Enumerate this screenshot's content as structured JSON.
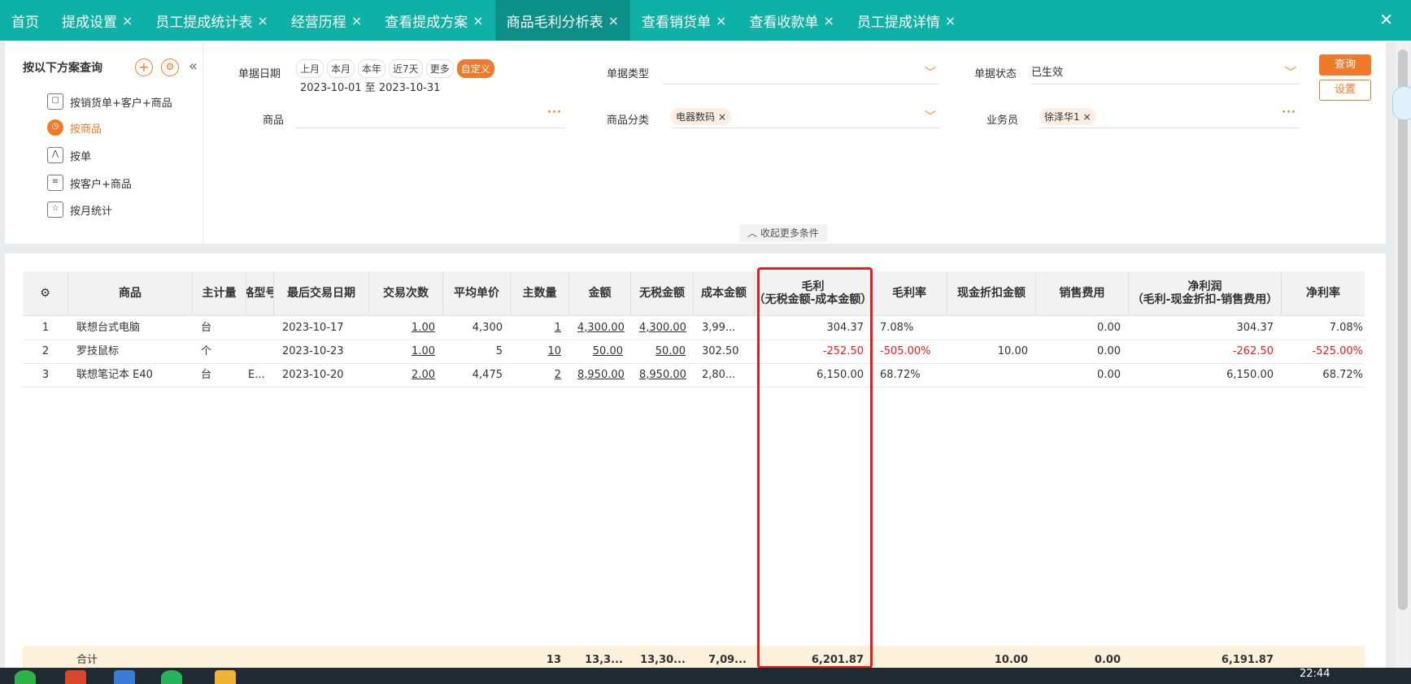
{
  "tabs": [
    {
      "label": "首页",
      "closable": false,
      "active": false
    },
    {
      "label": "提成设置",
      "closable": true,
      "active": false
    },
    {
      "label": "员工提成统计表",
      "closable": true,
      "active": false
    },
    {
      "label": "经营历程",
      "closable": true,
      "active": false
    },
    {
      "label": "查看提成方案",
      "closable": true,
      "active": false
    },
    {
      "label": "商品毛利分析表",
      "closable": true,
      "active": true
    },
    {
      "label": "查看销货单",
      "closable": true,
      "active": false
    },
    {
      "label": "查看收款单",
      "closable": true,
      "active": false
    },
    {
      "label": "员工提成详情",
      "closable": true,
      "active": false
    }
  ],
  "icons": {
    "close": "×",
    "close_window": "✕",
    "plus": "+",
    "gear": "⚙",
    "collapse": "«",
    "caret": "﹀",
    "fold": "︿"
  },
  "side": {
    "title": "按以下方案查询",
    "items": [
      {
        "label": "按销货单+客户+商品",
        "icon": "cube-icon",
        "active": false
      },
      {
        "label": "按商品",
        "icon": "clock-icon",
        "active": true
      },
      {
        "label": "按单",
        "icon": "chart-icon",
        "active": false
      },
      {
        "label": "按客户+商品",
        "icon": "list-icon",
        "active": false
      },
      {
        "label": "按月统计",
        "icon": "star-icon",
        "active": false
      }
    ]
  },
  "filters": {
    "date_label": "单据日期",
    "quick": [
      "上月",
      "本月",
      "本年",
      "近7天",
      "更多",
      "自定义"
    ],
    "quick_active": "自定义",
    "date_range": "2023-10-01 至 2023-10-31",
    "doc_type_label": "单据类型",
    "doc_type_value": "",
    "doc_status_label": "单据状态",
    "doc_status_value": "已生效",
    "product_label": "商品",
    "product_value": "",
    "category_label": "商品分类",
    "category_chip": "电器数码",
    "salesman_label": "业务员",
    "salesman_chip": "徐泽华1",
    "more_dots": "···",
    "query_btn": "查询",
    "setting_btn": "设置",
    "fold_label": "收起更多条件"
  },
  "table": {
    "headers": {
      "product": "商品",
      "unit": "主计量",
      "spec": "格型号",
      "last_date": "最后交易日期",
      "count": "交易次数",
      "avg_price": "平均单价",
      "qty": "主数量",
      "amount": "金额",
      "net_amount": "无税金额",
      "cost": "成本金额",
      "gross_line1": "毛利",
      "gross_line2": "（无税金额-成本金额）",
      "gross_rate": "毛利率",
      "discount": "现金折扣金额",
      "sales_expense": "销售费用",
      "net_profit_line1": "净利润",
      "net_profit_line2": "（毛利-现金折扣-销售费用）",
      "net_rate": "净利率"
    },
    "rows": [
      {
        "no": "1",
        "product": "联想台式电脑",
        "unit": "台",
        "spec": "",
        "last_date": "2023-10-17",
        "count": "1.00",
        "avg_price": "4,300",
        "qty": "1",
        "amount": "4,300.00",
        "net_amount": "4,300.00",
        "cost": "3,99...",
        "gross": "304.37",
        "gross_rate": "7.08%",
        "discount": "",
        "sales_expense": "0.00",
        "net_profit": "304.37",
        "net_rate": "7.08%",
        "negative": false
      },
      {
        "no": "2",
        "product": "罗技鼠标",
        "unit": "个",
        "spec": "",
        "last_date": "2023-10-23",
        "count": "1.00",
        "avg_price": "5",
        "qty": "10",
        "amount": "50.00",
        "net_amount": "50.00",
        "cost": "302.50",
        "gross": "-252.50",
        "gross_rate": "-505.00%",
        "discount": "10.00",
        "sales_expense": "0.00",
        "net_profit": "-262.50",
        "net_rate": "-525.00%",
        "negative": true
      },
      {
        "no": "3",
        "product": "联想笔记本  E40",
        "unit": "台",
        "spec": "E...",
        "last_date": "2023-10-20",
        "count": "2.00",
        "avg_price": "4,475",
        "qty": "2",
        "amount": "8,950.00",
        "net_amount": "8,950.00",
        "cost": "2,80...",
        "gross": "6,150.00",
        "gross_rate": "68.72%",
        "discount": "",
        "sales_expense": "0.00",
        "net_profit": "6,150.00",
        "net_rate": "68.72%",
        "negative": false
      }
    ],
    "total": {
      "label": "合计",
      "qty": "13",
      "amount": "13,3...",
      "net_amount": "13,30...",
      "cost": "7,09...",
      "gross": "6,201.87",
      "discount": "10.00",
      "sales_expense": "0.00",
      "net_profit": "6,191.87"
    }
  },
  "taskbar": {
    "time": "22:44"
  },
  "colors": {
    "tab_bg": "#0fb0a5",
    "tab_active": "#0b8f87",
    "accent": "#f07a2c",
    "negative": "#e02020",
    "total_bg": "#fdf1dc"
  }
}
